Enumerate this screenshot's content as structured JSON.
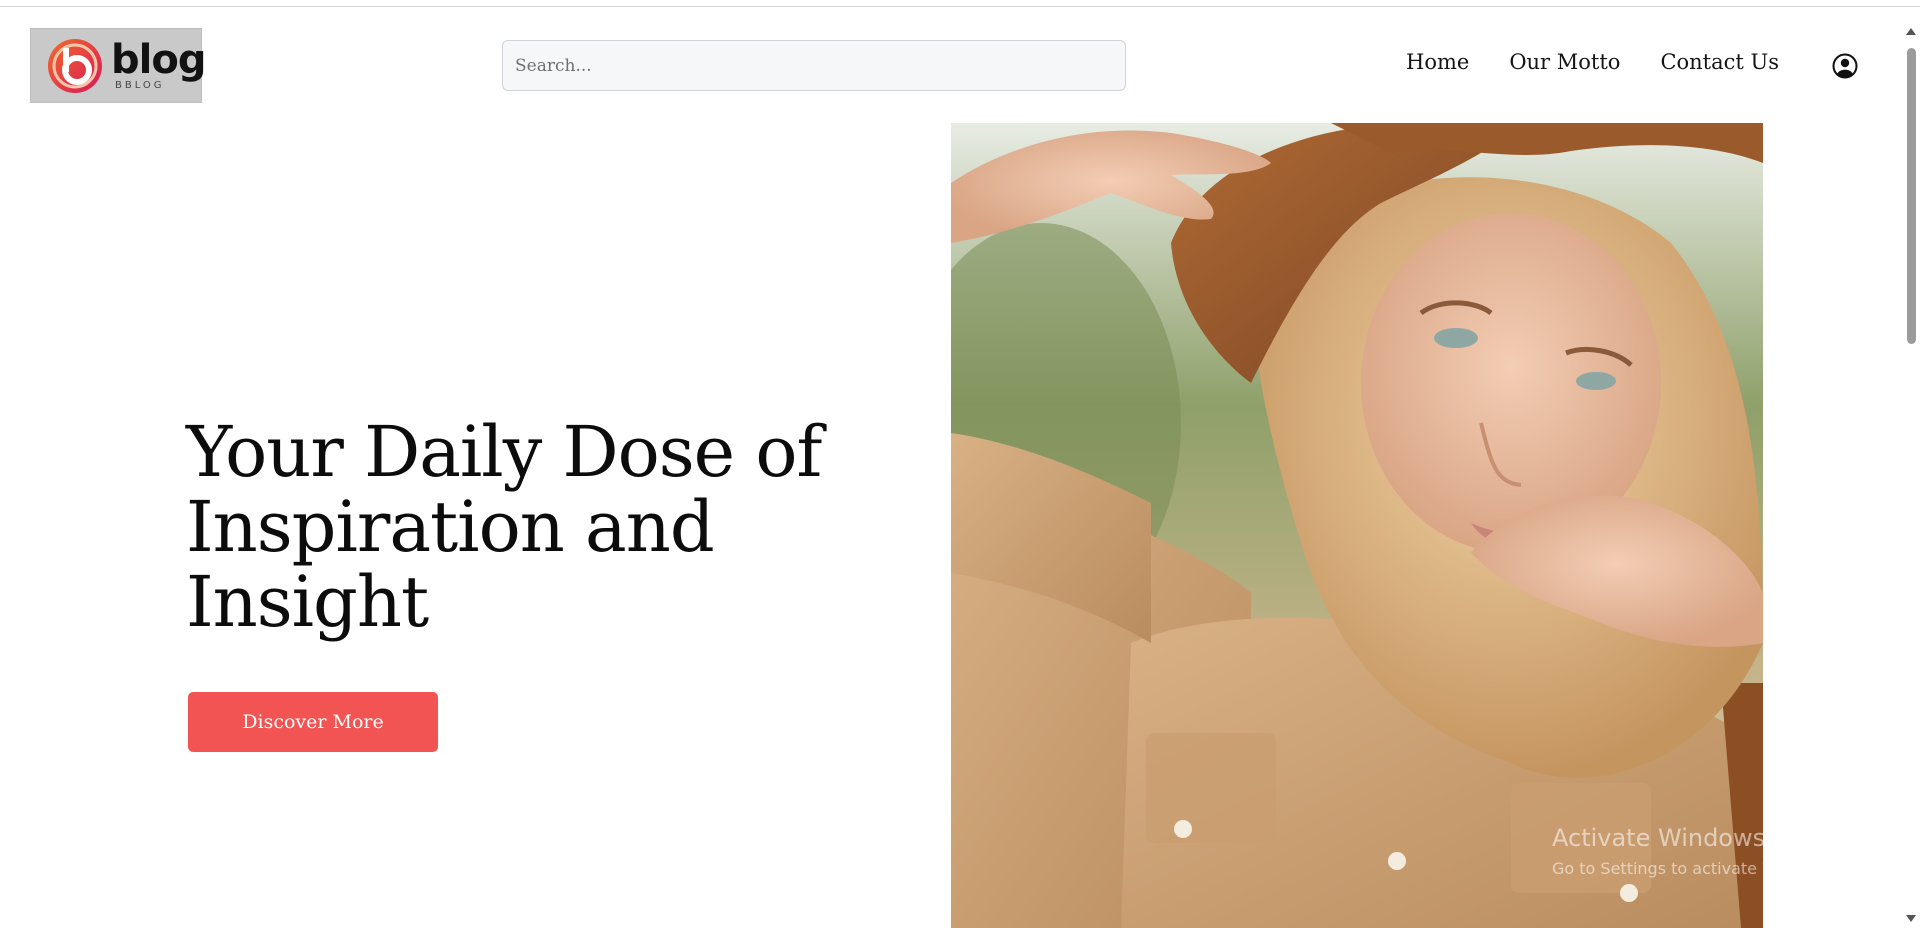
{
  "header": {
    "logo": {
      "wordmark": "blog",
      "subtext": "BBLOG"
    },
    "search": {
      "placeholder": "Search..."
    },
    "nav": {
      "items": [
        {
          "label": "Home"
        },
        {
          "label": "Our Motto"
        },
        {
          "label": "Contact Us"
        }
      ],
      "user_icon": "user-circle-icon"
    }
  },
  "hero": {
    "title": "Your Daily Dose of Inspiration and Insight",
    "cta_label": "Discover More",
    "image": "woman-straw-hat-photo"
  },
  "watermark": {
    "title": "Activate Windows",
    "subtitle": "Go to Settings to activate Windows."
  },
  "colors": {
    "accent": "#f25454",
    "text": "#0c0c0c",
    "search_bg": "#f6f7f9"
  }
}
